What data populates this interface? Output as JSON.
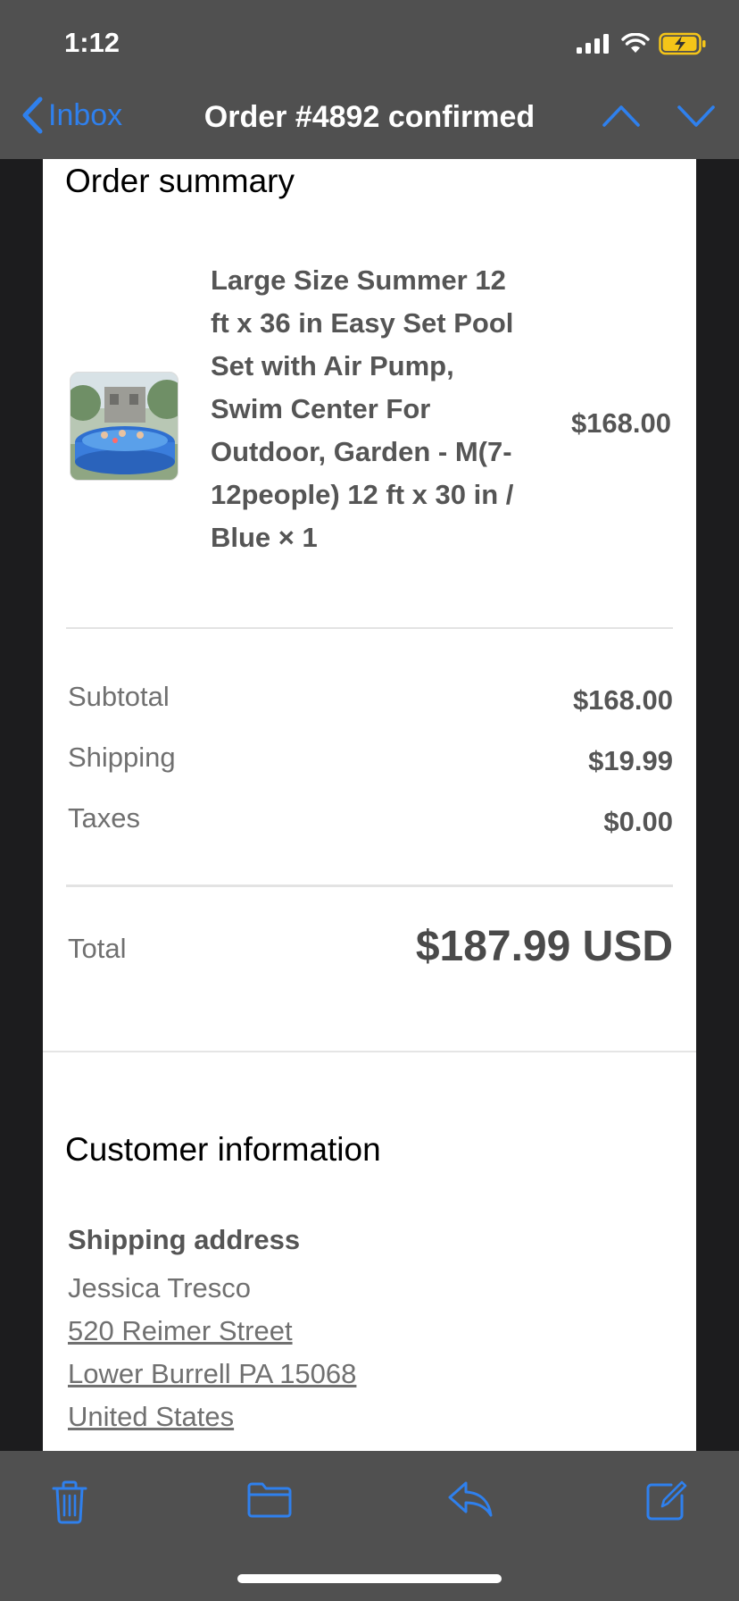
{
  "status_bar": {
    "time": "1:12"
  },
  "nav": {
    "back_label": "Inbox",
    "title": "Order #4892 confirmed"
  },
  "order_summary": {
    "heading": "Order summary",
    "product": {
      "name": "Large Size Summer 12 ft x 36 in Easy Set Pool Set with Air Pump, Swim Center For Outdoor, Garden - M(7-12people) 12 ft x 30 in / Blue × 1",
      "price": "$168.00"
    },
    "subtotal_label": "Subtotal",
    "subtotal_value": "$168.00",
    "shipping_label": "Shipping",
    "shipping_value": "$19.99",
    "taxes_label": "Taxes",
    "taxes_value": "$0.00",
    "total_label": "Total",
    "total_value": "$187.99 USD"
  },
  "customer": {
    "heading": "Customer information",
    "shipping_heading": "Shipping address",
    "name": "Jessica Tresco",
    "street": "520 Reimer Street",
    "city": "Lower Burrell PA 15068",
    "country": "United States"
  },
  "toolbar": {
    "icons": [
      "trash-icon",
      "folder-icon",
      "reply-icon",
      "compose-icon"
    ]
  },
  "colors": {
    "accent": "#2f80ed",
    "bar_bg": "#505050",
    "battery": "#f5c518"
  }
}
